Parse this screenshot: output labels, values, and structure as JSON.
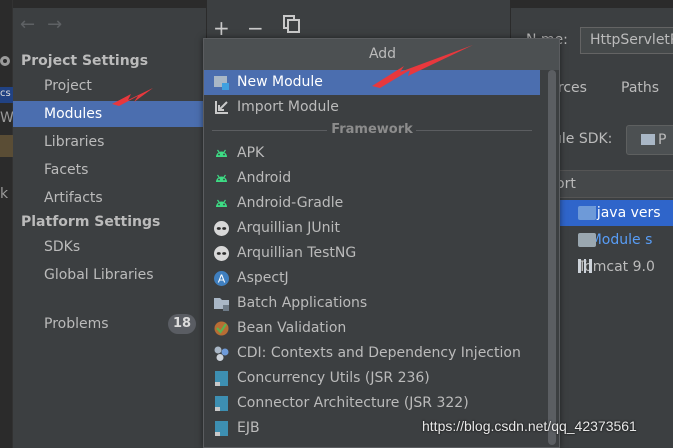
{
  "sidebar": {
    "sections": [
      {
        "label": "Project Settings",
        "items": [
          "Project",
          "Modules",
          "Libraries",
          "Facets",
          "Artifacts"
        ]
      },
      {
        "label": "Platform Settings",
        "items": [
          "SDKs",
          "Global Libraries"
        ]
      }
    ],
    "problems": {
      "label": "Problems",
      "count": "18"
    },
    "selected": "Modules"
  },
  "toolbar": {
    "add": "+",
    "remove": "−"
  },
  "popup": {
    "title": "Add",
    "items": [
      {
        "label": "New Module",
        "icon": "new-module-icon",
        "selected": true
      },
      {
        "label": "Import Module",
        "icon": "import-module-icon"
      }
    ],
    "separator": "Framework",
    "frameworks": [
      {
        "label": "APK",
        "icon": "android-icon"
      },
      {
        "label": "Android",
        "icon": "android-icon"
      },
      {
        "label": "Android-Gradle",
        "icon": "android-icon"
      },
      {
        "label": "Arquillian JUnit",
        "icon": "alien-icon"
      },
      {
        "label": "Arquillian TestNG",
        "icon": "alien-icon"
      },
      {
        "label": "AspectJ",
        "icon": "aspectj-icon"
      },
      {
        "label": "Batch Applications",
        "icon": "folder-icon"
      },
      {
        "label": "Bean Validation",
        "icon": "bean-icon"
      },
      {
        "label": "CDI: Contexts and Dependency Injection",
        "icon": "cdi-icon"
      },
      {
        "label": "Concurrency Utils (JSR 236)",
        "icon": "jee-icon"
      },
      {
        "label": "Connector Architecture (JSR 322)",
        "icon": "jee-icon"
      },
      {
        "label": "EJB",
        "icon": "jee-icon"
      }
    ]
  },
  "right": {
    "name_label": "N  me:",
    "name_value": "HttpServletR",
    "tabs": [
      "urces",
      "Paths"
    ],
    "sdk_label": "ule SDK:",
    "sdk_button": "P",
    "column_header": "ort",
    "rows": [
      {
        "label": "9 (java vers",
        "selected": true
      },
      {
        "label": "<Module s",
        "link": true
      },
      {
        "label": "Tomcat 9.0"
      }
    ]
  },
  "left_strip": [
    "cs",
    "W",
    "k"
  ],
  "watermark": "https://blog.csdn.net/qq_42373561",
  "colors": {
    "selection": "#4b6eaf",
    "background": "#3c3f41",
    "annotation_arrow": "#e8383d"
  }
}
